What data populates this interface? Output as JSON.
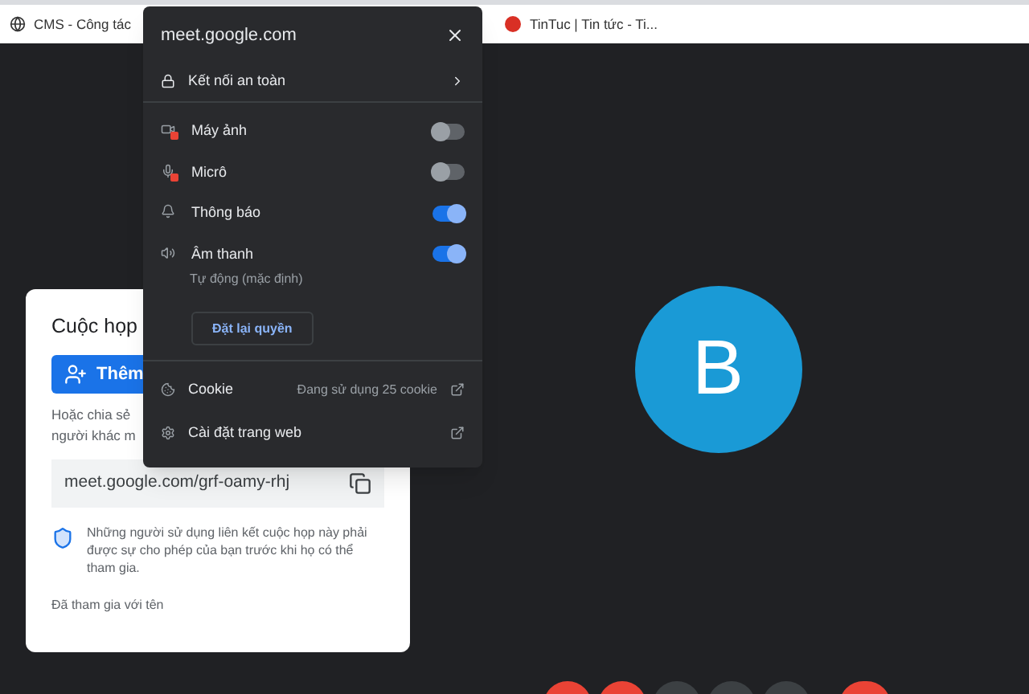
{
  "bookmarks": [
    {
      "label": "CMS - Công tác"
    },
    {
      "label": "TinTuc | Tin tức - Ti..."
    }
  ],
  "card": {
    "title": "Cuộc họp",
    "add_button": "Thêm",
    "share_lines": [
      "Hoặc chia sẻ",
      "người khác m"
    ],
    "link": "meet.google.com/grf-oamy-rhj",
    "notice": "Những người sử dụng liên kết cuộc họp này phải được sự cho phép của bạn trước khi họ có thể tham gia.",
    "joined": "Đã tham gia với tên"
  },
  "participant": {
    "initial": "B"
  },
  "controls": [
    {
      "kind": "circle",
      "color": "#ea4335"
    },
    {
      "kind": "circle",
      "color": "#ea4335"
    },
    {
      "kind": "circle",
      "color": "#3c4043"
    },
    {
      "kind": "circle",
      "color": "#3c4043"
    },
    {
      "kind": "circle",
      "color": "#3c4043"
    },
    {
      "kind": "pill",
      "color": "#ea4335"
    }
  ],
  "site_popup": {
    "title": "meet.google.com",
    "connection": "Kết nối an toàn",
    "permissions": [
      {
        "label": "Máy ảnh",
        "blocked": true,
        "on": false
      },
      {
        "label": "Micrô",
        "blocked": true,
        "on": false
      },
      {
        "label": "Thông báo",
        "blocked": false,
        "on": true
      },
      {
        "label": "Âm thanh",
        "blocked": false,
        "on": true,
        "subtitle": "Tự động (mặc định)"
      }
    ],
    "reset_button": "Đặt lại quyền",
    "links": [
      {
        "label": "Cookie",
        "detail": "Đang sử dụng 25 cookie"
      },
      {
        "label": "Cài đặt trang web"
      }
    ]
  }
}
